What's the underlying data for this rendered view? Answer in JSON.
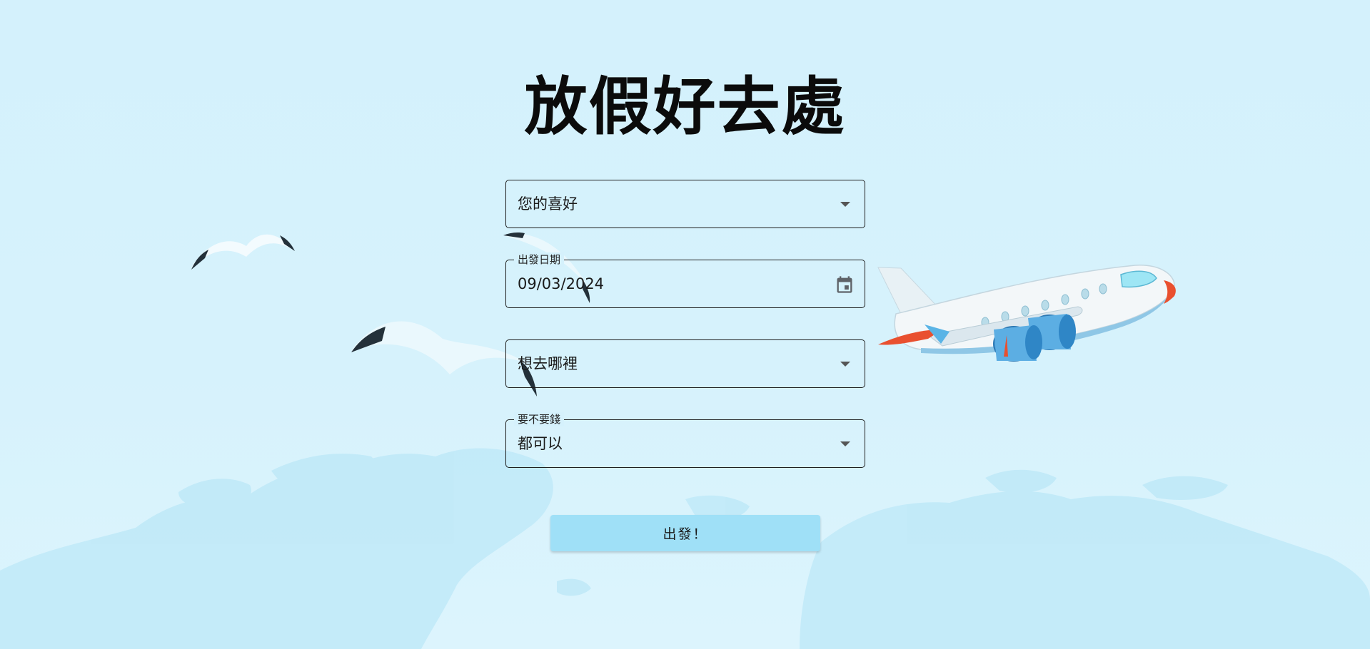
{
  "page": {
    "title": "放假好去處"
  },
  "form": {
    "preference": {
      "placeholder": "您的喜好"
    },
    "departure_date": {
      "label": "出發日期",
      "value": "09/03/2024"
    },
    "destination": {
      "placeholder": "想去哪裡"
    },
    "budget": {
      "label": "要不要錢",
      "value": "都可以"
    },
    "submit_label": "出發！"
  },
  "colors": {
    "background": "#d4f1fc",
    "button": "#9fe0f7",
    "map": "#bfe9f8"
  },
  "icons": {
    "select": "chevron-down-icon",
    "date": "calendar-icon"
  }
}
